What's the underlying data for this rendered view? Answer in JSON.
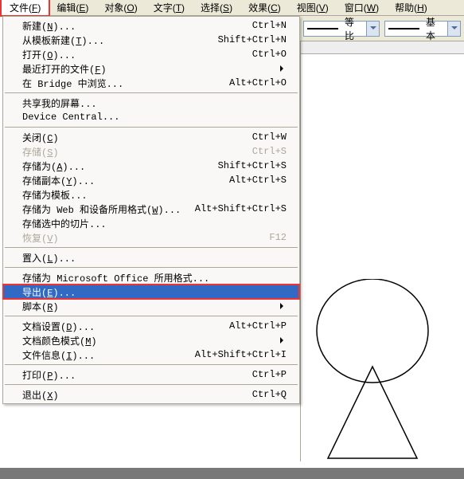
{
  "menubar": {
    "items": [
      "文件(F)",
      "编辑(E)",
      "对象(O)",
      "文字(T)",
      "选择(S)",
      "效果(C)",
      "视图(V)",
      "窗口(W)",
      "帮助(H)"
    ]
  },
  "toolbar": {
    "combo1_label": "等比",
    "combo2_label": "基本"
  },
  "menu": {
    "items": [
      {
        "label": "新建(N)...",
        "shortcut": "Ctrl+N"
      },
      {
        "label": "从模板新建(T)...",
        "shortcut": "Shift+Ctrl+N"
      },
      {
        "label": "打开(O)...",
        "shortcut": "Ctrl+O"
      },
      {
        "label": "最近打开的文件(F)",
        "submenu": true
      },
      {
        "label": "在 Bridge 中浏览...",
        "shortcut": "Alt+Ctrl+O"
      },
      {
        "sep": true
      },
      {
        "label": "共享我的屏幕...",
        "shortcut": ""
      },
      {
        "label": "Device Central...",
        "shortcut": ""
      },
      {
        "sep": true
      },
      {
        "label": "关闭(C)",
        "shortcut": "Ctrl+W"
      },
      {
        "label": "存储(S)",
        "shortcut": "Ctrl+S",
        "disabled": true
      },
      {
        "label": "存储为(A)...",
        "shortcut": "Shift+Ctrl+S"
      },
      {
        "label": "存储副本(Y)...",
        "shortcut": "Alt+Ctrl+S"
      },
      {
        "label": "存储为模板...",
        "shortcut": ""
      },
      {
        "label": "存储为 Web 和设备所用格式(W)...",
        "shortcut": "Alt+Shift+Ctrl+S"
      },
      {
        "label": "存储选中的切片...",
        "shortcut": ""
      },
      {
        "label": "恢复(V)",
        "shortcut": "F12",
        "disabled": true
      },
      {
        "sep": true
      },
      {
        "label": "置入(L)...",
        "shortcut": ""
      },
      {
        "sep": true
      },
      {
        "label": "存储为 Microsoft Office 所用格式...",
        "shortcut": ""
      },
      {
        "label": "导出(E)...",
        "shortcut": "",
        "selected": true,
        "boxed": true
      },
      {
        "label": "脚本(R)",
        "submenu": true
      },
      {
        "sep": true
      },
      {
        "label": "文档设置(D)...",
        "shortcut": "Alt+Ctrl+P"
      },
      {
        "label": "文档颜色模式(M)",
        "submenu": true
      },
      {
        "label": "文件信息(I)...",
        "shortcut": "Alt+Shift+Ctrl+I"
      },
      {
        "sep": true
      },
      {
        "label": "打印(P)...",
        "shortcut": "Ctrl+P"
      },
      {
        "sep": true
      },
      {
        "label": "退出(X)",
        "shortcut": "Ctrl+Q"
      }
    ]
  }
}
